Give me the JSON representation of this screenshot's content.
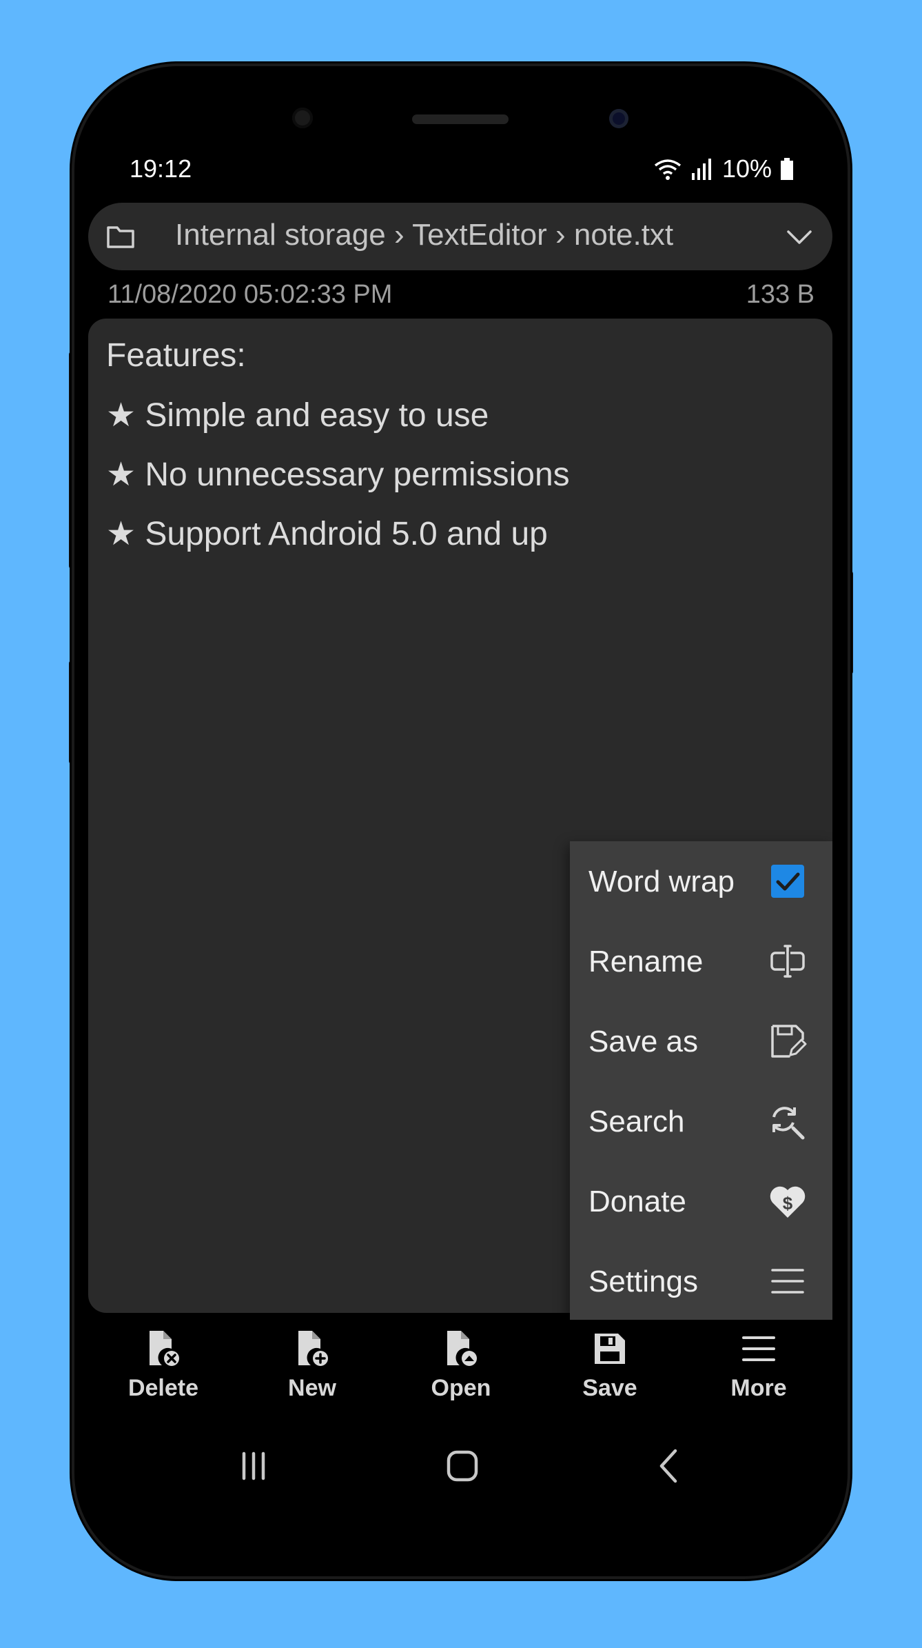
{
  "status": {
    "time": "19:12",
    "battery": "10%"
  },
  "path": {
    "folder_icon": "folder-icon",
    "segments": [
      "Internal storage",
      "TextEditor",
      "note.txt"
    ],
    "separator": "›",
    "dropdown_icon": "chevron-down-icon"
  },
  "file_meta": {
    "modified": "11/08/2020 05:02:33 PM",
    "size": "133 B"
  },
  "editor": {
    "lines": [
      "Features:",
      "★ Simple and easy to use",
      "★ No unnecessary permissions",
      "★ Support Android 5.0 and up"
    ]
  },
  "menu": {
    "items": [
      {
        "label": "Word wrap",
        "icon": "checkbox-checked-icon",
        "checked": true
      },
      {
        "label": "Rename",
        "icon": "rename-icon"
      },
      {
        "label": "Save as",
        "icon": "save-as-icon"
      },
      {
        "label": "Search",
        "icon": "search-replace-icon"
      },
      {
        "label": "Donate",
        "icon": "donate-heart-icon"
      },
      {
        "label": "Settings",
        "icon": "settings-menu-icon"
      }
    ]
  },
  "toolbar": {
    "buttons": [
      {
        "label": "Delete",
        "icon": "delete-file-icon"
      },
      {
        "label": "New",
        "icon": "new-file-icon"
      },
      {
        "label": "Open",
        "icon": "open-file-icon"
      },
      {
        "label": "Save",
        "icon": "save-icon"
      },
      {
        "label": "More",
        "icon": "more-menu-icon"
      }
    ]
  },
  "colors": {
    "background": "#5fb7fe",
    "surface": "#2a2a2a",
    "menu": "#3e3e3e",
    "accent": "#1e88e5",
    "text": "#dcdcdc"
  }
}
